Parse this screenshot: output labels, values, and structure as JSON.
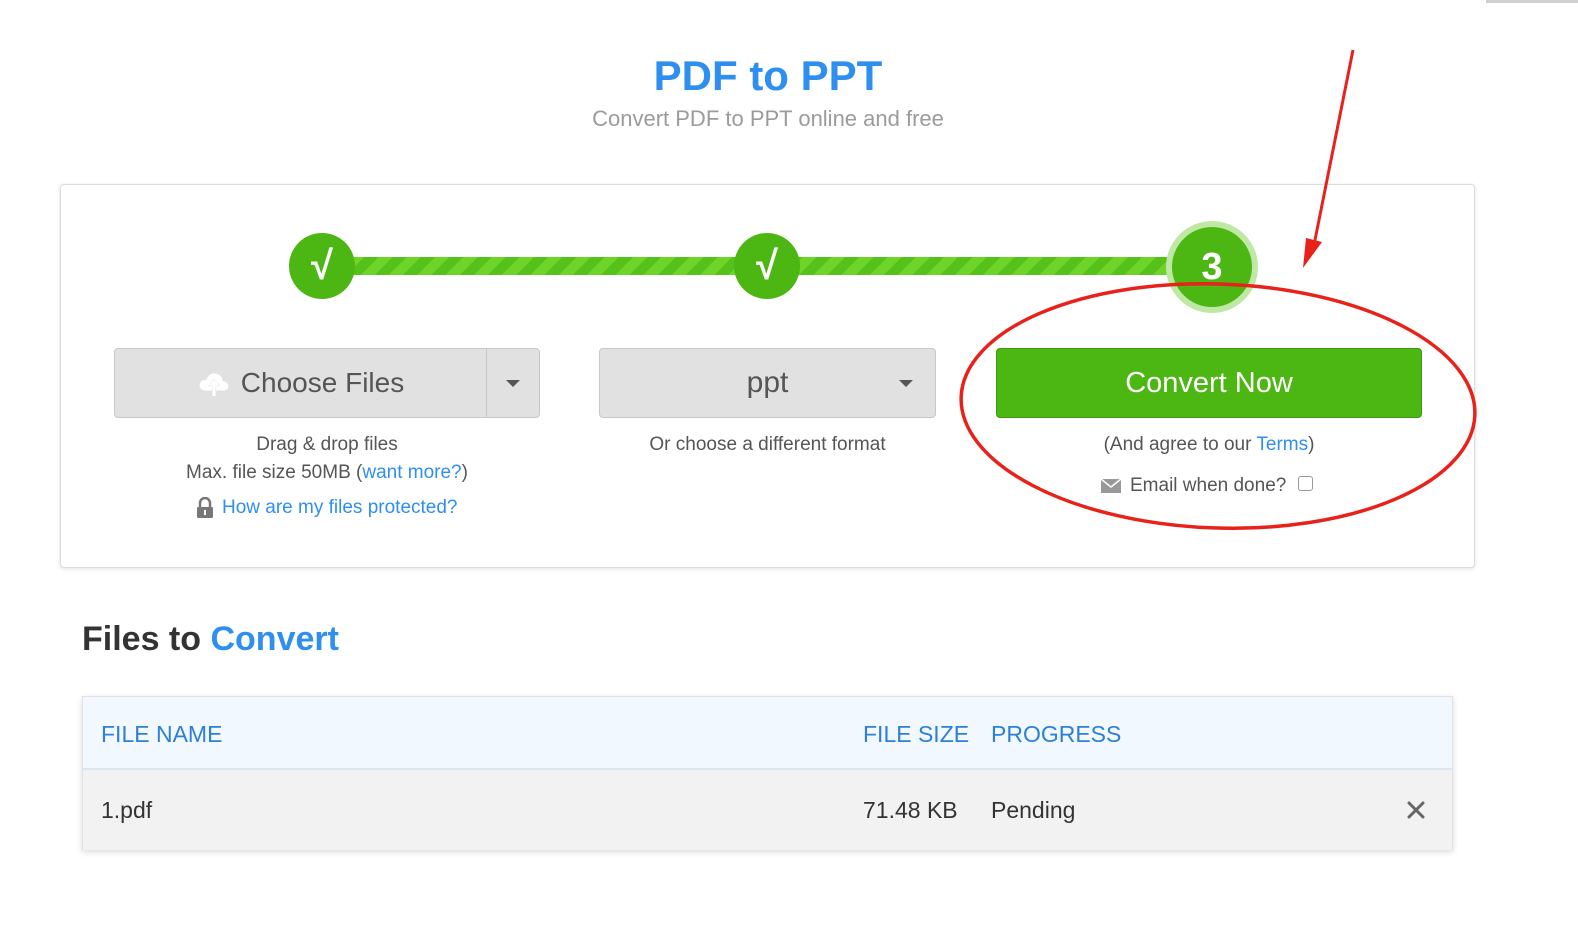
{
  "header": {
    "title": "PDF to PPT",
    "subtitle": "Convert PDF to PPT online and free"
  },
  "steps": [
    {
      "label": "√",
      "state": "done"
    },
    {
      "label": "√",
      "state": "done"
    },
    {
      "label": "3",
      "state": "active"
    }
  ],
  "upload": {
    "choose_label": "Choose Files",
    "drag_drop": "Drag & drop files",
    "max_size_prefix": "Max. file size 50MB (",
    "want_more_link": "want more?",
    "max_size_suffix": ")",
    "protected_link": "How are my files protected?"
  },
  "format": {
    "selected": "ppt",
    "hint": "Or choose a different format"
  },
  "convert": {
    "button_label": "Convert Now",
    "terms_prefix": "(And agree to our ",
    "terms_link": "Terms",
    "terms_suffix": ")",
    "email_label": "Email when done?",
    "email_checked": false
  },
  "files_section": {
    "title_part1": "Files to",
    "title_part2": "Convert",
    "columns": {
      "name": "FILE NAME",
      "size": "FILE SIZE",
      "progress": "PROGRESS"
    },
    "rows": [
      {
        "name": "1.pdf",
        "size": "71.48 KB",
        "progress": "Pending"
      }
    ]
  },
  "colors": {
    "brand_blue": "#2f8ff0",
    "green": "#4cb612",
    "annotation_red": "#e8221b"
  }
}
